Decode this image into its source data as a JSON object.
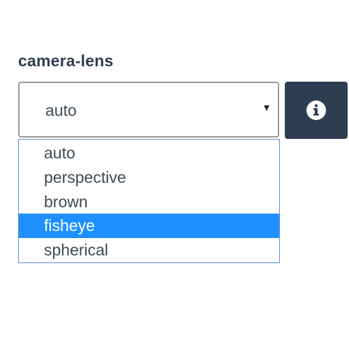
{
  "field": {
    "label": "camera-lens",
    "selected_value": "auto"
  },
  "dropdown": {
    "options": [
      {
        "label": "auto",
        "highlighted": false
      },
      {
        "label": "perspective",
        "highlighted": false
      },
      {
        "label": "brown",
        "highlighted": false
      },
      {
        "label": "fisheye",
        "highlighted": true
      },
      {
        "label": "spherical",
        "highlighted": false
      }
    ]
  },
  "icons": {
    "caret": "caret-down-icon",
    "info": "info-circle-icon"
  },
  "colors": {
    "label_text": "#2f3e50",
    "info_button_bg": "#2c3e50",
    "highlight_bg": "#1e90ff",
    "list_border": "#5b8fd1",
    "select_border": "#9a9a9a"
  }
}
